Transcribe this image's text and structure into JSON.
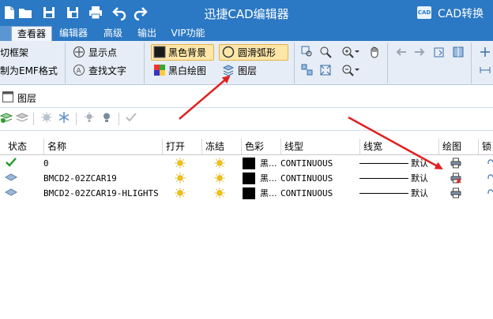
{
  "app": {
    "title": "迅捷CAD编辑器",
    "logo_text": "CAD",
    "convert_label": "CAD转换"
  },
  "tabs": [
    "查看器",
    "编辑器",
    "高级",
    "输出",
    "VIP功能"
  ],
  "active_tab": "查看器",
  "ribbon": {
    "left_items": [
      "切框架",
      "制为EMF格式"
    ],
    "show_points": "显示点",
    "find_text": "查找文字",
    "black_bg": "黑色背景",
    "bw_drawing": "黑白绘图",
    "smooth_arc": "圆滑弧形",
    "layers": "图层"
  },
  "panel": {
    "title": "图层"
  },
  "table": {
    "headers": [
      "状态",
      "名称",
      "打开",
      "冻结",
      "色彩",
      "线型",
      "线宽",
      "绘图",
      "锁"
    ],
    "rows": [
      {
        "name": "0",
        "color": "黑...",
        "linetype": "CONTINUOUS",
        "lineweight": "默认",
        "status": "current",
        "plot": "print"
      },
      {
        "name": "BMCD2-02ZCAR19",
        "color": "黑...",
        "linetype": "CONTINUOUS",
        "lineweight": "默认",
        "status": "layer",
        "plot": "no-print"
      },
      {
        "name": "BMCD2-02ZCAR19-HLIGHTS",
        "color": "黑...",
        "linetype": "CONTINUOUS",
        "lineweight": "默认",
        "status": "layer",
        "plot": "print"
      }
    ]
  },
  "colors": {
    "title_bar": "#2b78c4",
    "ribbon_bg": "#e6edf6",
    "highlight": "#fde6a8",
    "annotation_arrow": "#e02020"
  }
}
